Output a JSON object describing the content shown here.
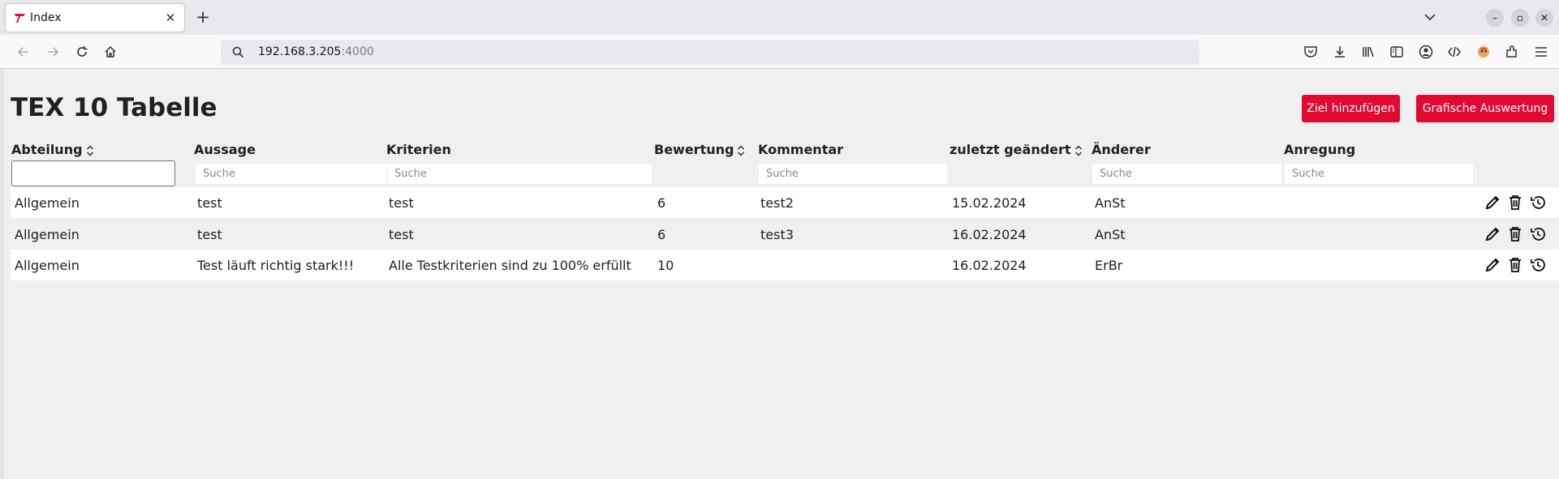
{
  "browser": {
    "tab_title": "Index",
    "url_host": "192.168.3.205",
    "url_port": ":4000"
  },
  "page": {
    "title": "TEX 10 Tabelle",
    "buttons": {
      "add_goal": "Ziel hinzufügen",
      "graphic_eval": "Grafische Auswertung"
    },
    "columns": {
      "abteilung": "Abteilung",
      "aussage": "Aussage",
      "kriterien": "Kriterien",
      "bewertung": "Bewertung",
      "kommentar": "Kommentar",
      "zuletzt": "zuletzt geändert",
      "aenderer": "Änderer",
      "anregung": "Anregung"
    },
    "search_placeholder": "Suche",
    "rows": [
      {
        "abteilung": "Allgemein",
        "aussage": "test",
        "kriterien": "test",
        "bewertung": "6",
        "kommentar": "test2",
        "zuletzt": "15.02.2024",
        "aenderer": "AnSt",
        "anregung": ""
      },
      {
        "abteilung": "Allgemein",
        "aussage": "test",
        "kriterien": "test",
        "bewertung": "6",
        "kommentar": "test3",
        "zuletzt": "16.02.2024",
        "aenderer": "AnSt",
        "anregung": ""
      },
      {
        "abteilung": "Allgemein",
        "aussage": "Test läuft richtig stark!!!",
        "kriterien": "Alle Testkriterien sind zu 100% erfüllt",
        "bewertung": "10",
        "kommentar": "",
        "zuletzt": "16.02.2024",
        "aenderer": "ErBr",
        "anregung": ""
      }
    ]
  },
  "colors": {
    "accent": "#e20a32",
    "row_white": "#ffffff",
    "page_bg": "#f0f0f0"
  },
  "icons": {
    "row_actions": [
      "pencil-icon",
      "trash-icon",
      "history-icon"
    ]
  }
}
